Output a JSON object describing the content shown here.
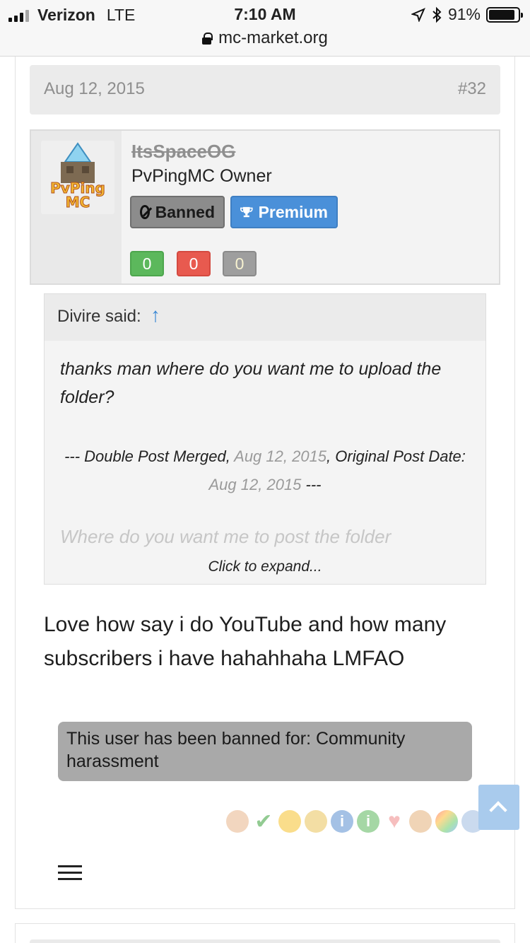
{
  "status_bar": {
    "carrier": "Verizon",
    "network": "LTE",
    "time": "7:10 AM",
    "battery": "91%",
    "battery_level": 0.91,
    "url": "mc-market.org"
  },
  "post": {
    "date": "Aug 12, 2015",
    "number": "#32",
    "user": {
      "name": "ItsSpaceOG",
      "title": "PvPingMC Owner",
      "avatar_text_1": "PvPing",
      "avatar_text_2": "MC",
      "badges": {
        "banned": "Banned",
        "premium": "Premium"
      },
      "ratings": {
        "positive": "0",
        "negative": "0",
        "neutral": "0"
      }
    },
    "quote": {
      "author": "Divire said:",
      "arrow": "↑",
      "line1": "thanks man where do you want me to upload the folder?",
      "merge_prefix": "--- Double Post Merged, ",
      "merge_date": "Aug 12, 2015",
      "merge_middle": ", Original Post Date: ",
      "orig_date": "Aug 12, 2015",
      "merge_suffix": " ---",
      "faded_line": "Where do you want me to post the folder",
      "expand": "Click to expand..."
    },
    "message": "Love how say i do YouTube and how many subscribers i have hahahhaha LMFAO",
    "ban_notice": "This user has been banned for: Community harassment",
    "reactions": [
      "thumbs-up",
      "check",
      "grin",
      "star-medal",
      "info",
      "info-green",
      "heart",
      "wrench",
      "rainbow",
      "paintbrush"
    ],
    "colors": {
      "premium": "#4a90d9",
      "positive": "#5cb85c",
      "negative": "#e85a4f",
      "neutral": "#9e9e9e"
    }
  }
}
